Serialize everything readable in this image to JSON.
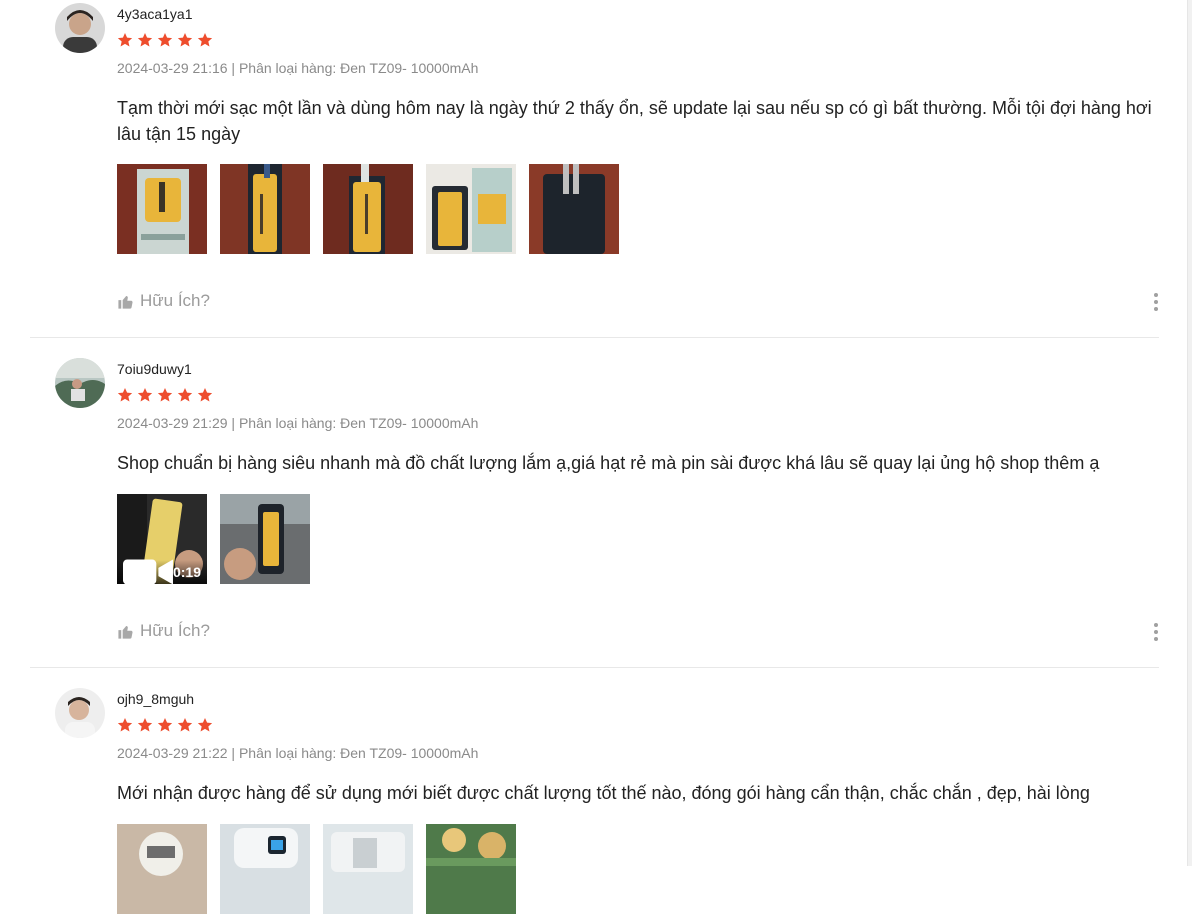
{
  "reviews": [
    {
      "username": "4y3aca1ya1",
      "rating": 5,
      "meta": "2024-03-29 21:16 | Phân loại hàng: Đen TZ09- 10000mAh",
      "comment": "Tạm thời mới sạc một lần và dùng hôm nay là ngày thứ 2 thấy ổn, sẽ update lại sau nếu sp có gì bất thường. Mỗi tội đợi hàng hơi lâu tận 15 ngày",
      "helpful_label": "Hữu Ích?"
    },
    {
      "username": "7oiu9duwy1",
      "rating": 5,
      "meta": "2024-03-29 21:29 | Phân loại hàng: Đen TZ09- 10000mAh",
      "comment": "Shop chuẩn bị hàng siêu nhanh mà đồ chất lượng lắm ạ,giá hạt rẻ mà pin sài được khá lâu sẽ quay lại ủng hộ shop thêm ạ",
      "video_duration": "0:19",
      "helpful_label": "Hữu Ích?"
    },
    {
      "username": "ojh9_8mguh",
      "rating": 5,
      "meta": "2024-03-29 21:22 | Phân loại hàng: Đen TZ09- 10000mAh",
      "comment": "Mới nhận được hàng để sử dụng mới biết được chất lượng tốt thế nào, đóng gói hàng cẩn thận, chắc chắn , đẹp, hài lòng"
    }
  ],
  "colors": {
    "star": "#ee4d2d",
    "meta": "#8a8a8a",
    "helpful": "#9b9b9b"
  },
  "icons": {
    "star": "star-icon",
    "like": "thumbs-up-icon",
    "more": "more-vertical-icon",
    "video": "video-camera-icon"
  }
}
